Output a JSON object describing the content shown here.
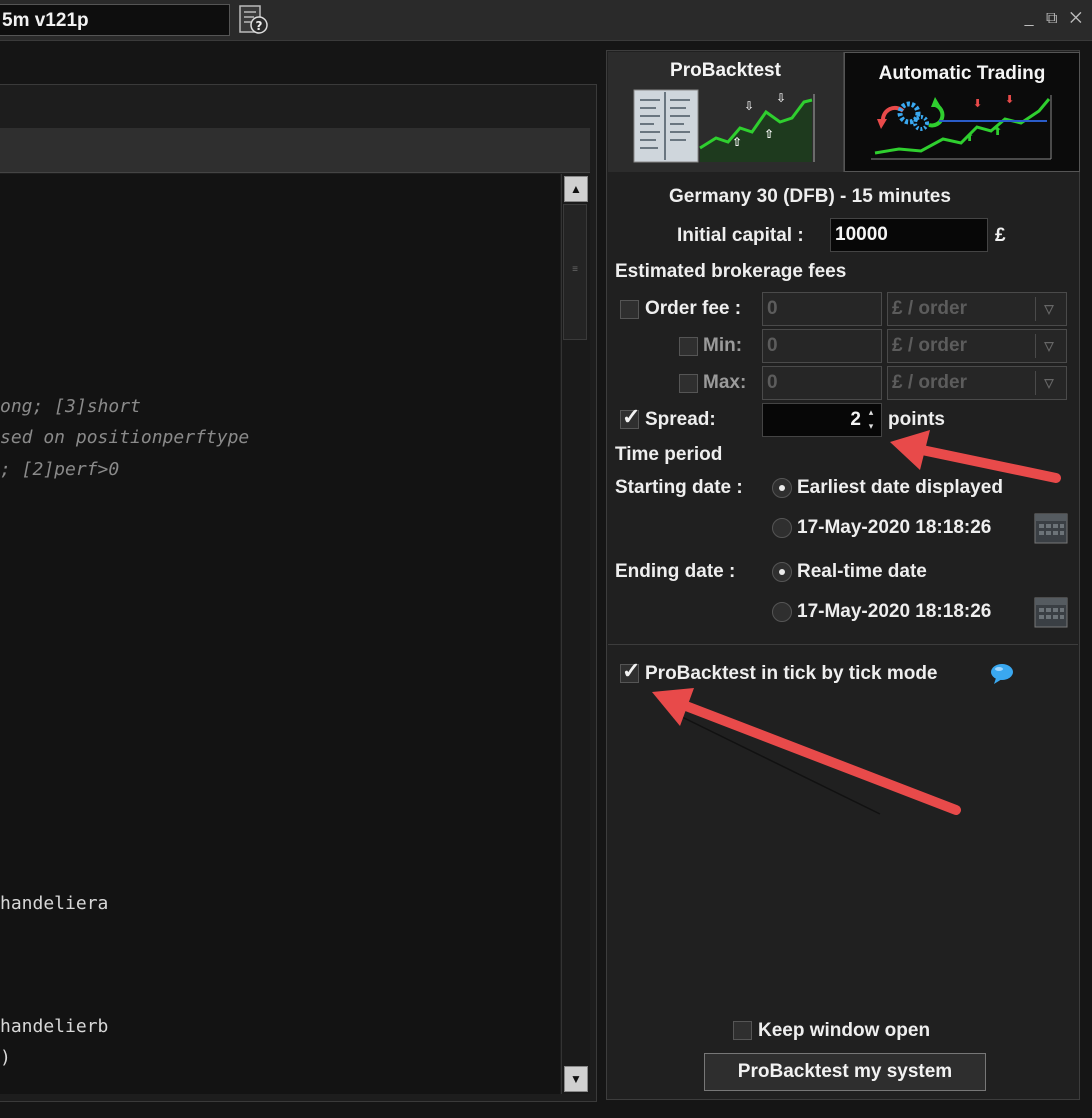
{
  "window": {
    "title_field": "5m v121p",
    "controls": "_ ⧉ ✕"
  },
  "editor": {
    "lines": [
      {
        "text": "ong; [3]short",
        "kind": "comment"
      },
      {
        "text": "sed on positionperftype",
        "kind": "comment"
      },
      {
        "text": "; [2]perf>0",
        "kind": "comment"
      },
      {
        "text": "handeliera",
        "kind": "plain"
      },
      {
        "text": "handelierb",
        "kind": "plain"
      },
      {
        "text": ")",
        "kind": "plain"
      }
    ]
  },
  "tabs": {
    "probacktest": "ProBacktest",
    "automatic_trading": "Automatic Trading"
  },
  "backtest": {
    "instrument": "Germany 30 (DFB) - 15 minutes",
    "initial_capital_label": "Initial capital :",
    "initial_capital_value": "10000",
    "currency_symbol": "£",
    "fees_heading": "Estimated brokerage fees",
    "order_fee_label": "Order fee :",
    "order_fee_value": "0",
    "order_fee_unit": "£ / order",
    "min_label": "Min:",
    "min_value": "0",
    "min_unit": "£ / order",
    "max_label": "Max:",
    "max_value": "0",
    "max_unit": "£ / order",
    "spread_label": "Spread:",
    "spread_value": "2",
    "spread_unit": "points",
    "time_period_heading": "Time period",
    "starting_date_label": "Starting date :",
    "start_option_earliest": "Earliest date displayed",
    "start_option_date": "17-May-2020 18:18:26",
    "ending_date_label": "Ending date :",
    "end_option_realtime": "Real-time date",
    "end_option_date": "17-May-2020 18:18:26",
    "tick_mode_label": "ProBacktest in tick by tick mode",
    "keep_window_open_label": "Keep window open",
    "run_button": "ProBacktest my system"
  },
  "state": {
    "order_fee_checked": false,
    "min_checked": false,
    "max_checked": false,
    "spread_checked": true,
    "start_selected": "earliest",
    "end_selected": "realtime",
    "tick_mode_checked": true,
    "keep_window_open_checked": false
  },
  "colors": {
    "annotation_arrow": "#e84a4a",
    "chart_green": "#2fcf2f",
    "info_bubble": "#3aa8f0"
  },
  "icons": [
    "help-document-icon",
    "calendar-icon",
    "info-bubble-icon",
    "chevron-down-icon",
    "scroll-up-icon",
    "scroll-down-icon"
  ]
}
